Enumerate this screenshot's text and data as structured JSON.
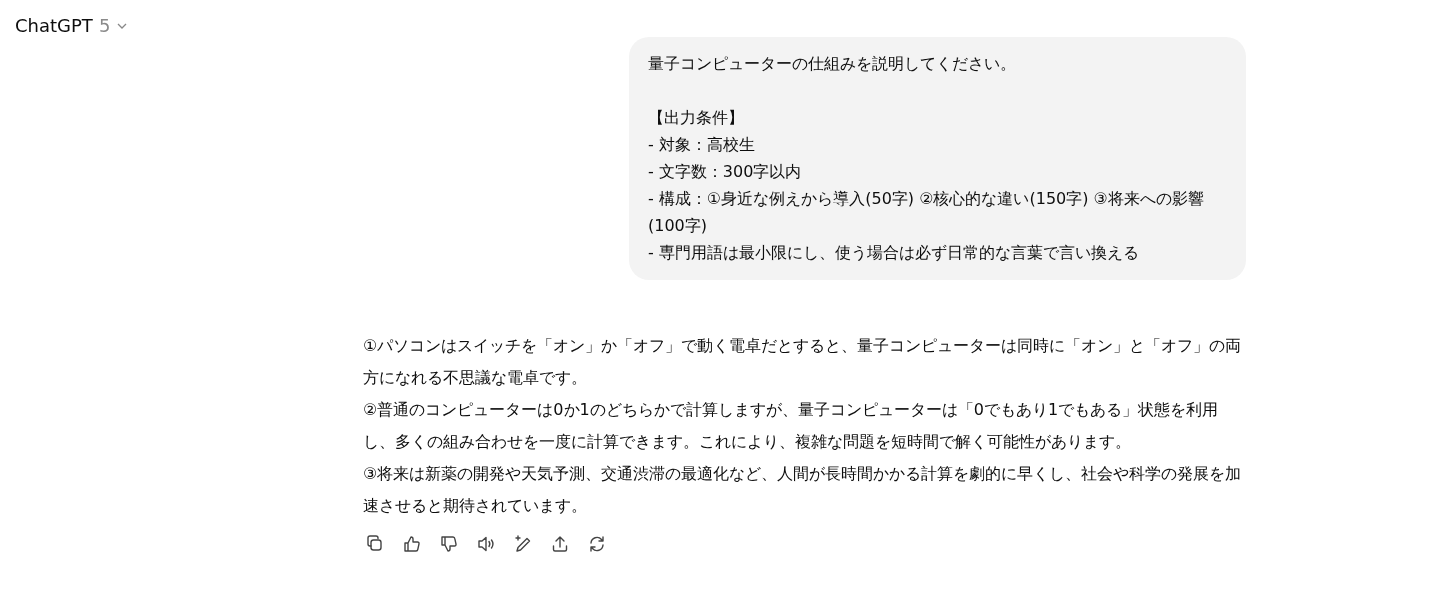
{
  "header": {
    "title": "ChatGPT",
    "version": "5"
  },
  "user_message": {
    "paragraphs": [
      [
        "量子コンピューターの仕組みを説明してください。"
      ],
      [
        "【出力条件】",
        "- 対象：高校生",
        "- 文字数：300字以内",
        "- 構成：①身近な例えから導入(50字) ②核心的な違い(150字) ③将来への影響(100字)",
        "- 専門用語は最小限にし、使う場合は必ず日常的な言葉で言い換える"
      ]
    ]
  },
  "assistant_message": {
    "paragraphs": [
      "①パソコンはスイッチを「オン」か「オフ」で動く電卓だとすると、量子コンピューターは同時に「オン」と「オフ」の両方になれる不思議な電卓です。",
      "②普通のコンピューターは0か1のどちらかで計算しますが、量子コンピューターは「0でもあり1でもある」状態を利用し、多くの組み合わせを一度に計算できます。これにより、複雑な問題を短時間で解く可能性があります。",
      "③将来は新薬の開発や天気予測、交通渋滞の最適化など、人間が長時間かかる計算を劇的に早くし、社会や科学の発展を加速させると期待されています。"
    ]
  },
  "actions": [
    {
      "kind": "copy"
    },
    {
      "kind": "like"
    },
    {
      "kind": "dislike"
    },
    {
      "kind": "read"
    },
    {
      "kind": "edit"
    },
    {
      "kind": "share"
    },
    {
      "kind": "retry"
    }
  ]
}
